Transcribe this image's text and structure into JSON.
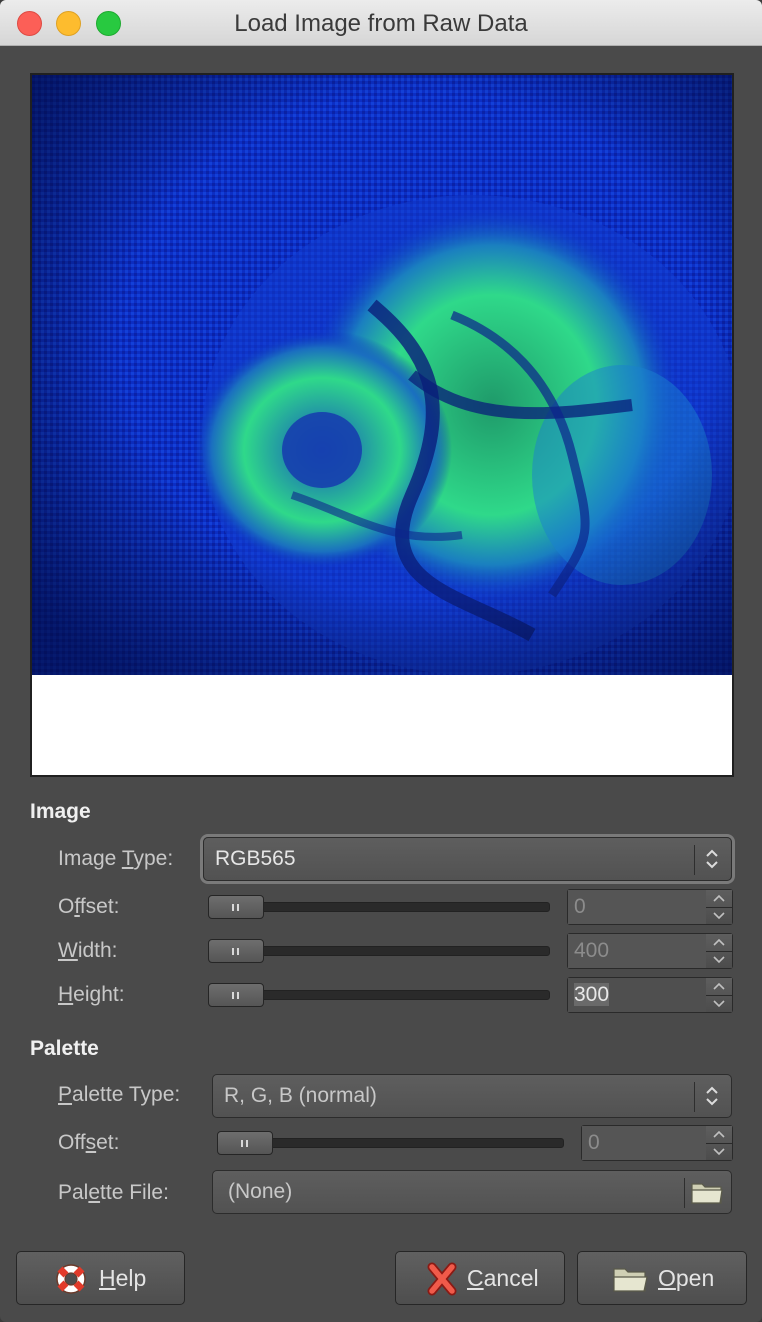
{
  "window": {
    "title": "Load Image from Raw Data"
  },
  "image_section": {
    "title": "Image",
    "image_type_label_pre": "Image ",
    "image_type_label_u": "T",
    "image_type_label_post": "ype:",
    "image_type_value": "RGB565",
    "offset_label_pre": "O",
    "offset_label_u": "f",
    "offset_label_post": "fset:",
    "offset_value": "0",
    "width_label_u": "W",
    "width_label_post": "idth:",
    "width_value": "400",
    "height_label_u": "H",
    "height_label_post": "eight:",
    "height_value": "300"
  },
  "palette_section": {
    "title": "Palette",
    "palette_type_label_u": "P",
    "palette_type_label_post": "alette Type:",
    "palette_type_value": "R, G, B (normal)",
    "offset_label_pre": "Off",
    "offset_label_u": "s",
    "offset_label_post": "et:",
    "offset_value": "0",
    "palette_file_label_pre": "Pal",
    "palette_file_label_u": "e",
    "palette_file_label_post": "tte File:",
    "palette_file_value": "(None)"
  },
  "buttons": {
    "help_u": "H",
    "help_post": "elp",
    "cancel_u": "C",
    "cancel_post": "ancel",
    "open_u": "O",
    "open_post": "pen"
  },
  "icons": {
    "help": "lifebuoy-icon",
    "cancel": "red-x-icon",
    "open": "folder-icon",
    "palette_file": "folder-icon",
    "combo": "up-down-chevron-icon"
  },
  "colors": {
    "nebula_background": "#0a2bb8",
    "nebula_glow": "#2fd98a",
    "window_bg": "#4a4a4a"
  }
}
